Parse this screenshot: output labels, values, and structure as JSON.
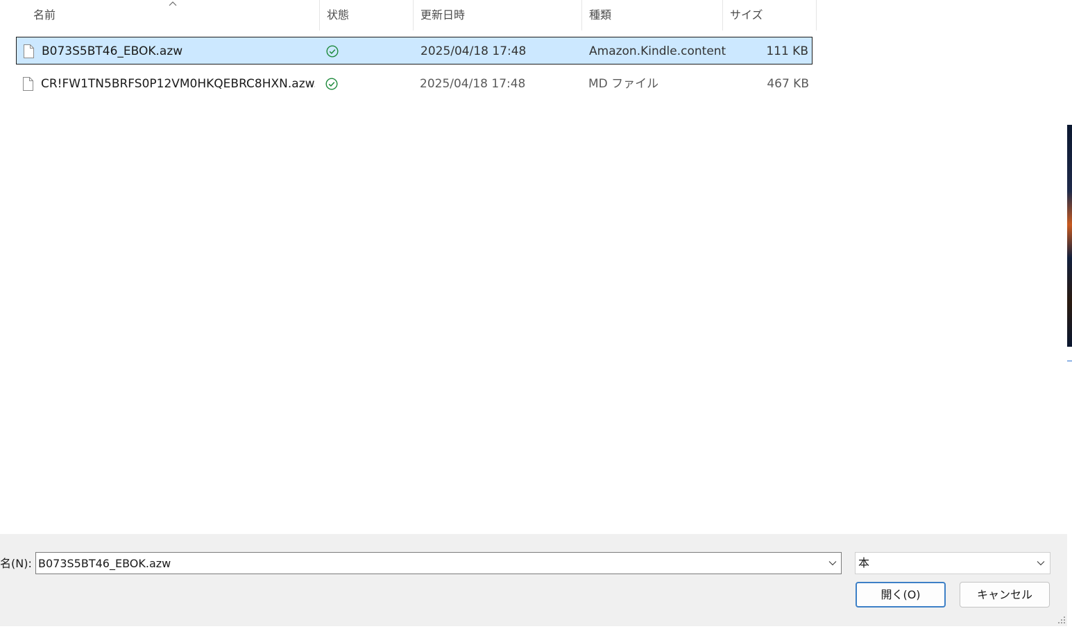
{
  "columns": {
    "name": "名前",
    "status": "状態",
    "modified": "更新日時",
    "type": "種類",
    "size": "サイズ"
  },
  "files": [
    {
      "name": "B073S5BT46_EBOK.azw",
      "modified": "2025/04/18 17:48",
      "type": "Amazon.Kindle.content",
      "size": "111 KB",
      "status_icon": "synced-check-icon",
      "selected": true
    },
    {
      "name": "CR!FW1TN5BRFS0P12VM0HKQEBRC8HXN.azw....",
      "modified": "2025/04/18 17:48",
      "type": "MD ファイル",
      "size": "467 KB",
      "status_icon": "synced-check-icon",
      "selected": false
    }
  ],
  "filename_label": "名(N):",
  "filename_value": "B073S5BT46_EBOK.azw",
  "filter_value": "本",
  "open_button": "開く(O)",
  "cancel_button": "キャンセル",
  "colors": {
    "selection_bg": "#cce8ff",
    "status_green": "#1e8a3c",
    "primary_border": "#3c7fc6",
    "panel_bg": "#f0f0f0"
  }
}
